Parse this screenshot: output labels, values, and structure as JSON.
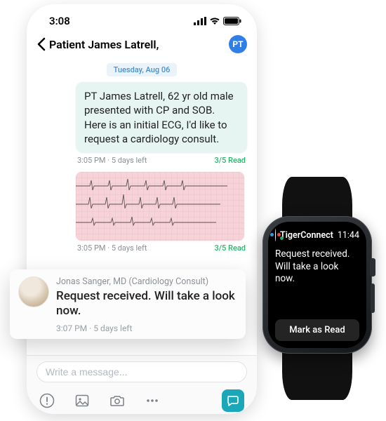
{
  "statusbar": {
    "time": "3:08"
  },
  "nav": {
    "title": "Patient James Latrell,",
    "avatar_initials": "PT"
  },
  "date_label": "Tuesday, Aug 06",
  "msg1": {
    "text": "PT James Latrell, 62 yr old male presented with CP and SOB. Here is an initial ECG, I'd like to request a cardiology consult.",
    "meta": "3:05 PM · 5 days left",
    "read": "3/5 Read"
  },
  "msg2": {
    "meta": "3:05 PM · 5 days left",
    "read": "3/5 Read"
  },
  "notif": {
    "sender": "Jonas Sanger, MD (Cardiology Consult)",
    "text": "Request received. Will take a look now.",
    "meta": "3:07 PM · 5 days left"
  },
  "composer": {
    "placeholder": "Write a message..."
  },
  "watch": {
    "app": "TigerConnect",
    "time": "11:44",
    "message": "Request received. Will take a look now.",
    "button": "Mark as Read"
  }
}
